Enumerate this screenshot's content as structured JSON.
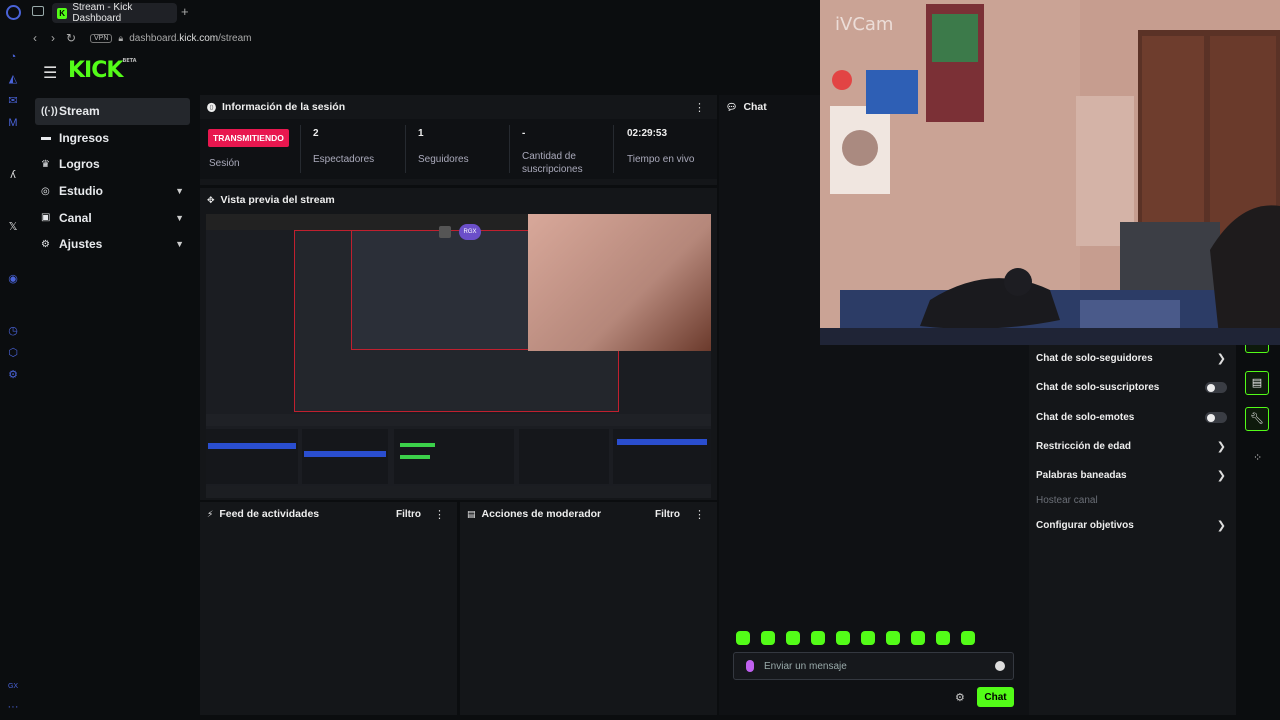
{
  "browser": {
    "tab_title": "Stream - Kick Dashboard",
    "url_prefix": "dashboard.",
    "url_host": "kick.com",
    "url_path": "/stream",
    "vpn_label": "VPN"
  },
  "brand": {
    "logo": "KICK",
    "beta": "BETA"
  },
  "nav": [
    {
      "label": "Stream",
      "icon": "stream-icon",
      "active": true
    },
    {
      "label": "Ingresos",
      "icon": "money-icon"
    },
    {
      "label": "Logros",
      "icon": "trophy-icon"
    },
    {
      "label": "Estudio",
      "icon": "studio-icon",
      "expandable": true
    },
    {
      "label": "Canal",
      "icon": "channel-icon",
      "expandable": true
    },
    {
      "label": "Ajustes",
      "icon": "settings-icon",
      "expandable": true
    }
  ],
  "session": {
    "title": "Información de la sesión",
    "status_badge": "TRANSMITIENDO",
    "status_label": "Sesión",
    "viewers_value": "2",
    "viewers_label": "Espectadores",
    "followers_value": "1",
    "followers_label": "Seguidores",
    "subs_value": "-",
    "subs_label": "Cantidad de suscripciones",
    "uptime_value": "02:29:53",
    "uptime_label": "Tiempo en vivo"
  },
  "preview": {
    "title": "Vista previa del stream"
  },
  "activity": {
    "title": "Feed de actividades",
    "filter": "Filtro"
  },
  "modactions": {
    "title": "Acciones de moderador",
    "filter": "Filtro"
  },
  "chat": {
    "title": "Chat",
    "placeholder": "Enviar un mensaje",
    "send_label": "Chat",
    "emote_count": 10
  },
  "chat_settings": [
    {
      "label": "Chat de solo-seguidores",
      "control": "arrow"
    },
    {
      "label": "Chat de solo-suscriptores",
      "control": "toggle",
      "on": false
    },
    {
      "label": "Chat de solo-emotes",
      "control": "toggle",
      "on": false
    },
    {
      "label": "Restricción de edad",
      "control": "arrow"
    },
    {
      "label": "Palabras baneadas",
      "control": "arrow"
    },
    {
      "label": "Hostear canal",
      "control": "none",
      "disabled": true
    },
    {
      "label": "Configurar objetivos",
      "control": "arrow"
    }
  ],
  "camera": {
    "watermark": "iVCam"
  },
  "colors": {
    "accent": "#53fc18",
    "live": "#e8174f",
    "bg": "#0b0d0f",
    "panel": "#141619"
  }
}
